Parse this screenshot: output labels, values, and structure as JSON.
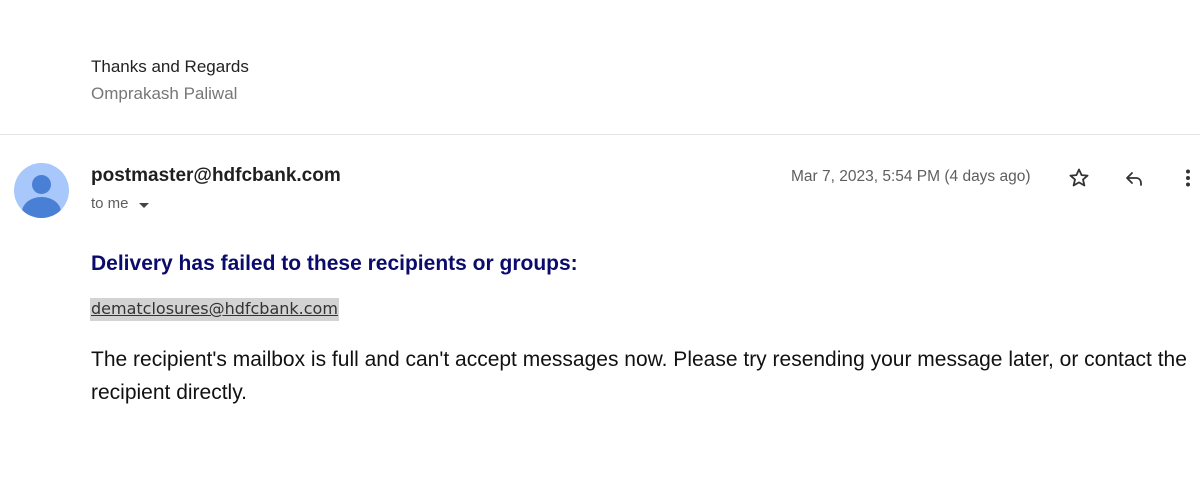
{
  "previous_message": {
    "signature_line1": "Thanks and Regards",
    "signature_line2": "Omprakash Paliwal"
  },
  "message": {
    "sender_email": "postmaster@hdfcbank.com",
    "recipient_label": "to me",
    "date": "Mar 7, 2023, 5:54 PM (4 days ago)",
    "heading": "Delivery has failed to these recipients or groups:",
    "failed_recipient": "dematclosures@hdfcbank.com",
    "body": "The recipient's mailbox is full and can't accept messages now. Please try resending your message later, or contact the recipient directly."
  },
  "icons": {
    "avatar": "person-avatar-icon",
    "star": "star-icon",
    "reply": "reply-icon",
    "more": "more-vert-icon",
    "dropdown": "caret-down-icon"
  },
  "colors": {
    "avatar_bg": "#a8c7fa",
    "avatar_fg": "#4a7fd6",
    "heading": "#0b0b6b",
    "recipient_highlight": "#d3d3d3"
  }
}
